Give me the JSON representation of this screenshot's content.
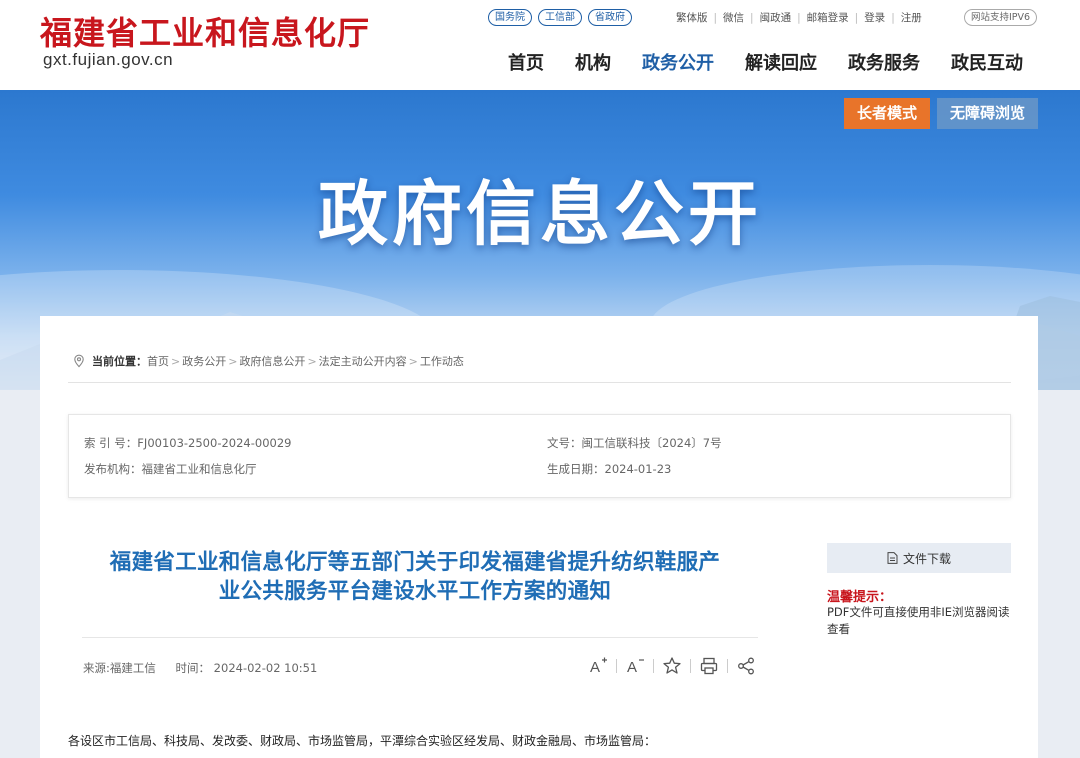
{
  "header": {
    "site_name": "福建省工业和信息化厅",
    "domain": "gxt.fujian.gov.cn",
    "badges": [
      "国务院",
      "工信部",
      "省政府"
    ],
    "top_links": [
      "繁体版",
      "微信",
      "闽政通",
      "邮箱登录",
      "登录",
      "注册"
    ],
    "ipv6": "网站支持IPV6",
    "nav": [
      "首页",
      "机构",
      "政务公开",
      "解读回应",
      "政务服务",
      "政民互动"
    ]
  },
  "banner": {
    "title": "政府信息公开",
    "elder_mode": "长者模式",
    "accessible": "无障碍浏览"
  },
  "breadcrumb": {
    "label": "当前位置：",
    "items": [
      "首页",
      "政务公开",
      "政府信息公开",
      "法定主动公开内容",
      "工作动态"
    ]
  },
  "meta": {
    "index_no": "索 引 号：FJ00103-2500-2024-00029",
    "doc_no": "文号：闽工信联科技〔2024〕7号",
    "publisher": "发布机构：福建省工业和信息化厅",
    "created": "生成日期：2024-01-23"
  },
  "article": {
    "title_line1": "福建省工业和信息化厅等五部门关于印发福建省提升纺织鞋服产",
    "title_line2": "业公共服务平台建设水平工作方案的通知",
    "source": "来源:福建工信",
    "time": "时间： 2024-02-02 10:51",
    "body_first_line": "各设区市工信局、科技局、发改委、财政局、市场监管局，平潭综合实验区经发局、财政金融局、市场监管局："
  },
  "sidebar": {
    "download": "文件下载",
    "tip_title": "温馨提示：",
    "tip_text": "PDF文件可直接使用非IE浏览器阅读查看"
  },
  "colors": {
    "brand_red": "#c8161d",
    "brand_blue": "#1f5fa6",
    "title_blue": "#1f6db5",
    "elder_orange": "#e8742a"
  }
}
